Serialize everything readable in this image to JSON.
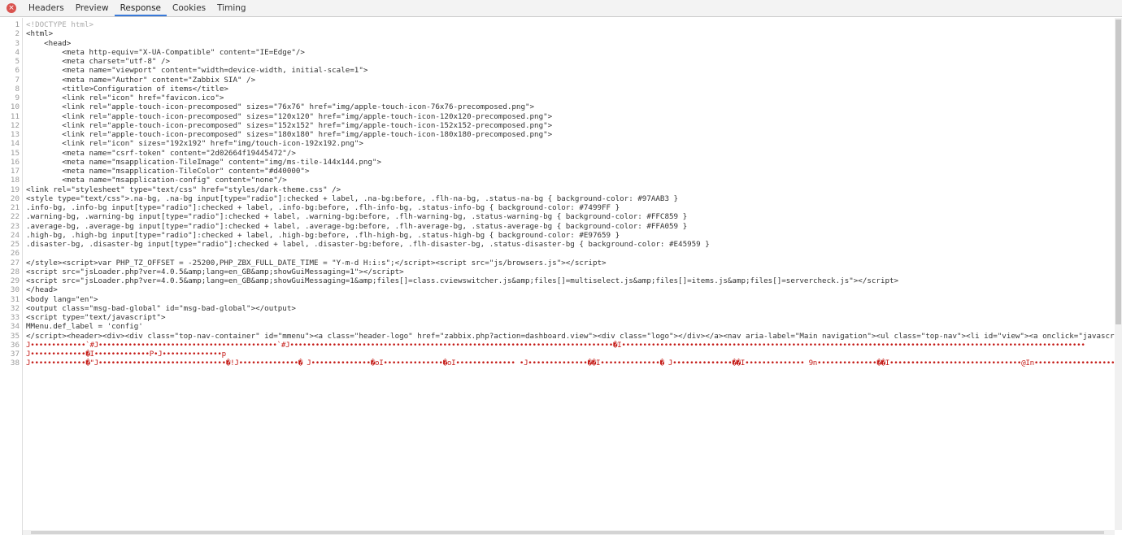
{
  "tabs": {
    "close_icon": "×",
    "items": [
      "Headers",
      "Preview",
      "Response",
      "Cookies",
      "Timing"
    ],
    "active": "Response"
  },
  "lines": [
    "<!DOCTYPE html>",
    "<html>",
    "    <head>",
    "        <meta http-equiv=\"X-UA-Compatible\" content=\"IE=Edge\"/>",
    "        <meta charset=\"utf-8\" />",
    "        <meta name=\"viewport\" content=\"width=device-width, initial-scale=1\">",
    "        <meta name=\"Author\" content=\"Zabbix SIA\" />",
    "        <title>Configuration of items</title>",
    "        <link rel=\"icon\" href=\"favicon.ico\">",
    "        <link rel=\"apple-touch-icon-precomposed\" sizes=\"76x76\" href=\"img/apple-touch-icon-76x76-precomposed.png\">",
    "        <link rel=\"apple-touch-icon-precomposed\" sizes=\"120x120\" href=\"img/apple-touch-icon-120x120-precomposed.png\">",
    "        <link rel=\"apple-touch-icon-precomposed\" sizes=\"152x152\" href=\"img/apple-touch-icon-152x152-precomposed.png\">",
    "        <link rel=\"apple-touch-icon-precomposed\" sizes=\"180x180\" href=\"img/apple-touch-icon-180x180-precomposed.png\">",
    "        <link rel=\"icon\" sizes=\"192x192\" href=\"img/touch-icon-192x192.png\">",
    "        <meta name=\"csrf-token\" content=\"2d02664f19445472\"/>",
    "        <meta name=\"msapplication-TileImage\" content=\"img/ms-tile-144x144.png\">",
    "        <meta name=\"msapplication-TileColor\" content=\"#d40000\">",
    "        <meta name=\"msapplication-config\" content=\"none\"/>",
    "<link rel=\"stylesheet\" type=\"text/css\" href=\"styles/dark-theme.css\" />",
    "<style type=\"text/css\">.na-bg, .na-bg input[type=\"radio\"]:checked + label, .na-bg:before, .flh-na-bg, .status-na-bg { background-color: #97AAB3 }",
    ".info-bg, .info-bg input[type=\"radio\"]:checked + label, .info-bg:before, .flh-info-bg, .status-info-bg { background-color: #7499FF }",
    ".warning-bg, .warning-bg input[type=\"radio\"]:checked + label, .warning-bg:before, .flh-warning-bg, .status-warning-bg { background-color: #FFC859 }",
    ".average-bg, .average-bg input[type=\"radio\"]:checked + label, .average-bg:before, .flh-average-bg, .status-average-bg { background-color: #FFA059 }",
    ".high-bg, .high-bg input[type=\"radio\"]:checked + label, .high-bg:before, .flh-high-bg, .status-high-bg { background-color: #E97659 }",
    ".disaster-bg, .disaster-bg input[type=\"radio\"]:checked + label, .disaster-bg:before, .flh-disaster-bg, .status-disaster-bg { background-color: #E45959 }",
    "",
    "</style><script>var PHP_TZ_OFFSET = -25200,PHP_ZBX_FULL_DATE_TIME = \"Y-m-d H:i:s\";</script><script src=\"js/browsers.js\"></script>",
    "<script src=\"jsLoader.php?ver=4.0.5&amp;lang=en_GB&amp;showGuiMessaging=1\"></script>",
    "<script src=\"jsLoader.php?ver=4.0.5&amp;lang=en_GB&amp;showGuiMessaging=1&amp;files[]=class.cviewswitcher.js&amp;files[]=multiselect.js&amp;files[]=items.js&amp;files[]=servercheck.js\"></script>",
    "</head>",
    "<body lang=\"en\">",
    "<output class=\"msg-bad-global\" id=\"msg-bad-global\"></output>",
    "<script type=\"text/javascript\">",
    "MMenu.def_label = 'config'",
    "</script><header><div><div class=\"top-nav-container\" id=\"mmenu\"><a class=\"header-logo\" href=\"zabbix.php?action=dashboard.view\"><div class=\"logo\"></div></a><nav aria-label=\"Main navigation\"><ul class=\"top-nav\"><li id=\"view\"><a onclick=\"javascript: MMenu.",
    "J•••••••••••••`#J••••••••••••••••••••••••••••••••••••••••••`#J••••••••••••••••••••••••••••••••••••••••••••••••••••••••••••••••••••••••••••�I•••••••••••••••••••••••••••••••••••••••••••••••••••••••••••••••••••••••••••••••••••••••••••••••••••••••••••••",
    "J•••••••••••••�I•••••••••••••P•J••••••••••••••p",
    "J•••••••••••••�\"J••••••••••••••••••••••••••••••�!J••••••••••••••� J••••••••••••••�oI••••••••••••••�oI•••••••••••••• •J••••••••••••••��I••••••••••••••� J••••••••••••••��I•••••••••••••• 9n••••••••••••••��I•••••••••••••••••••••••••••••••@In•••••••••••••••••••••••"
  ]
}
